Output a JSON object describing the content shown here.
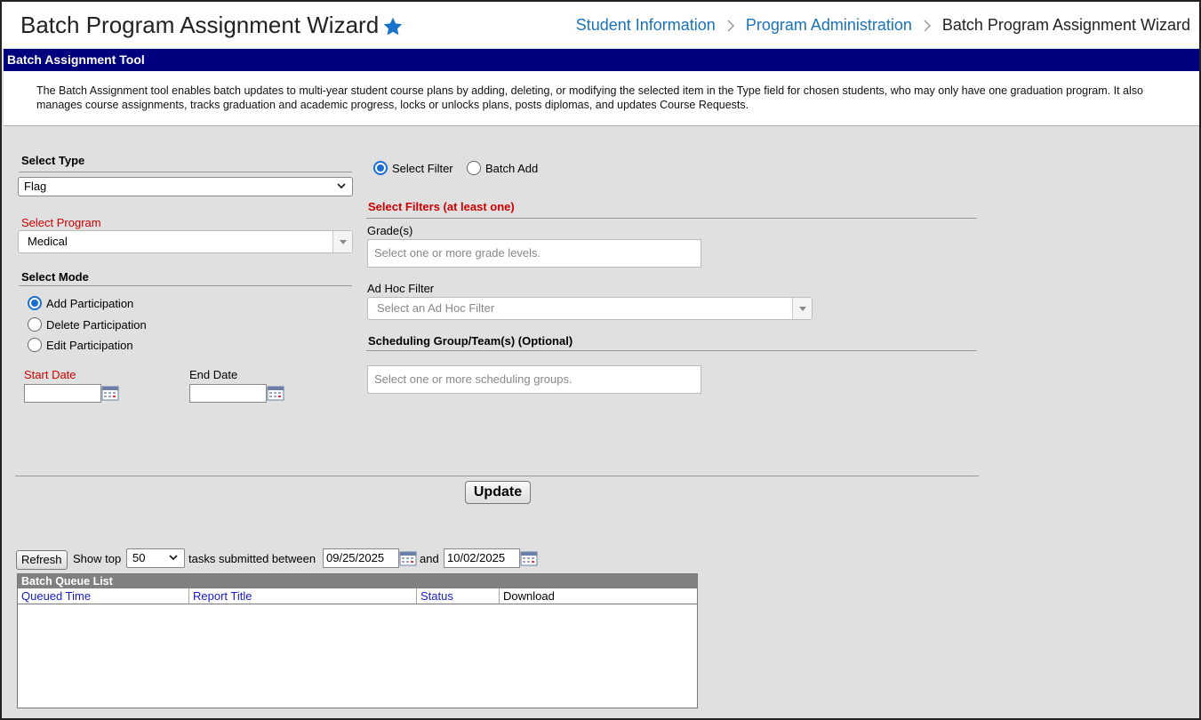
{
  "header": {
    "title": "Batch Program Assignment Wizard",
    "breadcrumb": [
      "Student Information",
      "Program Administration",
      "Batch Program Assignment Wizard"
    ]
  },
  "section": {
    "title": "Batch Assignment Tool",
    "description": "The Batch Assignment tool enables batch updates to multi-year student course plans by adding, deleting, or modifying the selected item in the Type field for chosen students, who may only have one graduation program. It also manages course assignments, tracks graduation and academic progress, locks or unlocks plans, posts diplomas, and updates Course Requests."
  },
  "left": {
    "select_type_label": "Select Type",
    "select_type_value": "Flag",
    "select_program_label": "Select Program",
    "select_program_value": "Medical",
    "select_mode_label": "Select Mode",
    "modes": [
      {
        "label": "Add Participation",
        "checked": true
      },
      {
        "label": "Delete Participation",
        "checked": false
      },
      {
        "label": "Edit Participation",
        "checked": false
      }
    ],
    "start_date_label": "Start Date",
    "start_date_value": "",
    "end_date_label": "End Date",
    "end_date_value": ""
  },
  "right": {
    "filter_options": [
      {
        "label": "Select Filter",
        "checked": true
      },
      {
        "label": "Batch Add",
        "checked": false
      }
    ],
    "filters_heading": "Select Filters (at least one)",
    "grades_label": "Grade(s)",
    "grades_placeholder": "Select one or more grade levels.",
    "adhoc_label": "Ad Hoc Filter",
    "adhoc_placeholder": "Select an Ad Hoc Filter",
    "scheduling_label": "Scheduling Group/Team(s) (Optional)",
    "scheduling_placeholder": "Select one or more scheduling groups."
  },
  "update_label": "Update",
  "queue_controls": {
    "refresh_label": "Refresh",
    "show_top_label": "Show top",
    "show_top_value": "50",
    "between_label": "tasks submitted between",
    "from_date": "09/25/2025",
    "and_label": "and",
    "to_date": "10/02/2025"
  },
  "queue": {
    "title": "Batch Queue List",
    "columns": [
      "Queued Time",
      "Report Title",
      "Status",
      "Download"
    ]
  },
  "colors": {
    "header_bar": "#00007f",
    "link": "#1a73b8",
    "required": "#cc0000",
    "star": "#1a73c8"
  }
}
